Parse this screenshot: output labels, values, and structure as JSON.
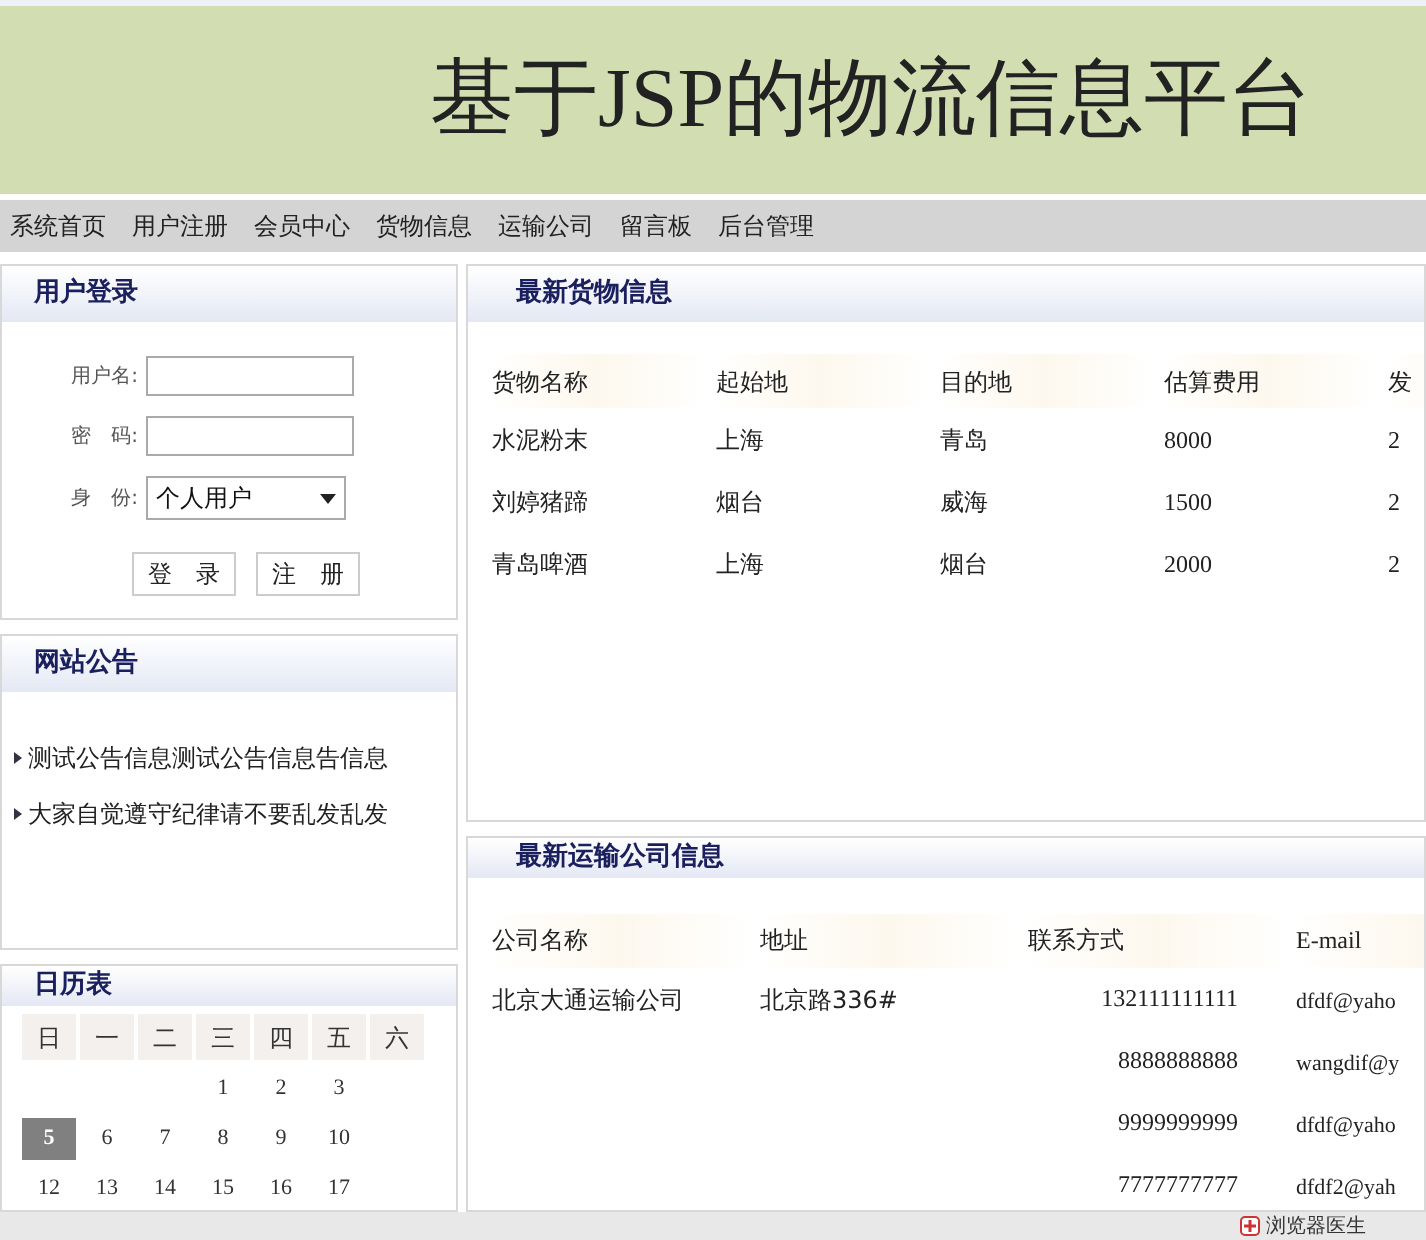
{
  "header": {
    "title": "基于JSP的物流信息平台"
  },
  "nav": [
    "系统首页",
    "用户注册",
    "会员中心",
    "货物信息",
    "运输公司",
    "留言板",
    "后台管理"
  ],
  "login": {
    "title": "用户登录",
    "fields": [
      {
        "kind": "text",
        "label": "用户名:"
      },
      {
        "kind": "text",
        "label": "密　码:"
      },
      {
        "kind": "select",
        "label": "身　份:",
        "value": "个人用户"
      }
    ],
    "buttons": [
      "登　录",
      "注　册"
    ]
  },
  "notices": {
    "title": "网站公告",
    "items": [
      "测试公告信息测试公告信息告信息",
      "大家自觉遵守纪律请不要乱发乱发"
    ]
  },
  "calendar": {
    "title": "日历表",
    "weekdays": [
      "日",
      "一",
      "二",
      "三",
      "四",
      "五",
      "六"
    ],
    "weeks": [
      [
        {
          "kind": "empty"
        },
        {
          "kind": "empty"
        },
        {
          "kind": "empty"
        },
        {
          "kind": "day",
          "day": "1",
          "selected": false
        },
        {
          "kind": "day",
          "day": "2",
          "selected": false
        },
        {
          "kind": "day",
          "day": "3",
          "selected": false
        }
      ],
      [
        {
          "kind": "day",
          "day": "5",
          "selected": true
        },
        {
          "kind": "day",
          "day": "6",
          "selected": false
        },
        {
          "kind": "day",
          "day": "7",
          "selected": false
        },
        {
          "kind": "day",
          "day": "8",
          "selected": false
        },
        {
          "kind": "day",
          "day": "9",
          "selected": false
        },
        {
          "kind": "day",
          "day": "10",
          "selected": false
        }
      ],
      [
        {
          "kind": "day",
          "day": "12",
          "selected": false
        },
        {
          "kind": "day",
          "day": "13",
          "selected": false
        },
        {
          "kind": "day",
          "day": "14",
          "selected": false
        },
        {
          "kind": "day",
          "day": "15",
          "selected": false
        },
        {
          "kind": "day",
          "day": "16",
          "selected": false
        },
        {
          "kind": "day",
          "day": "17",
          "selected": false
        }
      ]
    ]
  },
  "cargo": {
    "title": "最新货物信息",
    "columns": [
      "货物名称",
      "起始地",
      "目的地",
      "估算费用",
      "发"
    ],
    "rows": [
      [
        "水泥粉末",
        "上海",
        "青岛",
        "8000",
        "2"
      ],
      [
        "刘婷猪蹄",
        "烟台",
        "威海",
        "1500",
        "2"
      ],
      [
        "青岛啤酒",
        "上海",
        "烟台",
        "2000",
        "2"
      ]
    ]
  },
  "companies": {
    "title": "最新运输公司信息",
    "columns": [
      "公司名称",
      "地址",
      "联系方式",
      "E-mail"
    ],
    "rows": [
      {
        "name": "北京大通运输公司",
        "address": "北京路336#",
        "phone": "132111111111",
        "email": "dfdf@yaho"
      },
      {
        "phone": "8888888888",
        "email": "wangdif@y"
      },
      {
        "phone": "9999999999",
        "email": "dfdf@yaho"
      },
      {
        "phone": "7777777777",
        "email": "dfdf2@yah"
      }
    ]
  },
  "status_bar": {
    "text": "浏览器医生"
  }
}
